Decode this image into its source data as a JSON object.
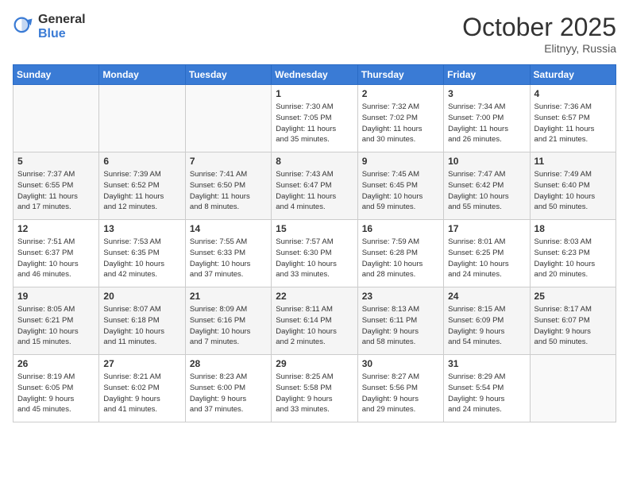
{
  "header": {
    "logo_general": "General",
    "logo_blue": "Blue",
    "month_title": "October 2025",
    "location": "Elitnyy, Russia"
  },
  "days_of_week": [
    "Sunday",
    "Monday",
    "Tuesday",
    "Wednesday",
    "Thursday",
    "Friday",
    "Saturday"
  ],
  "weeks": [
    [
      {
        "day": "",
        "info": ""
      },
      {
        "day": "",
        "info": ""
      },
      {
        "day": "",
        "info": ""
      },
      {
        "day": "1",
        "info": "Sunrise: 7:30 AM\nSunset: 7:05 PM\nDaylight: 11 hours\nand 35 minutes."
      },
      {
        "day": "2",
        "info": "Sunrise: 7:32 AM\nSunset: 7:02 PM\nDaylight: 11 hours\nand 30 minutes."
      },
      {
        "day": "3",
        "info": "Sunrise: 7:34 AM\nSunset: 7:00 PM\nDaylight: 11 hours\nand 26 minutes."
      },
      {
        "day": "4",
        "info": "Sunrise: 7:36 AM\nSunset: 6:57 PM\nDaylight: 11 hours\nand 21 minutes."
      }
    ],
    [
      {
        "day": "5",
        "info": "Sunrise: 7:37 AM\nSunset: 6:55 PM\nDaylight: 11 hours\nand 17 minutes."
      },
      {
        "day": "6",
        "info": "Sunrise: 7:39 AM\nSunset: 6:52 PM\nDaylight: 11 hours\nand 12 minutes."
      },
      {
        "day": "7",
        "info": "Sunrise: 7:41 AM\nSunset: 6:50 PM\nDaylight: 11 hours\nand 8 minutes."
      },
      {
        "day": "8",
        "info": "Sunrise: 7:43 AM\nSunset: 6:47 PM\nDaylight: 11 hours\nand 4 minutes."
      },
      {
        "day": "9",
        "info": "Sunrise: 7:45 AM\nSunset: 6:45 PM\nDaylight: 10 hours\nand 59 minutes."
      },
      {
        "day": "10",
        "info": "Sunrise: 7:47 AM\nSunset: 6:42 PM\nDaylight: 10 hours\nand 55 minutes."
      },
      {
        "day": "11",
        "info": "Sunrise: 7:49 AM\nSunset: 6:40 PM\nDaylight: 10 hours\nand 50 minutes."
      }
    ],
    [
      {
        "day": "12",
        "info": "Sunrise: 7:51 AM\nSunset: 6:37 PM\nDaylight: 10 hours\nand 46 minutes."
      },
      {
        "day": "13",
        "info": "Sunrise: 7:53 AM\nSunset: 6:35 PM\nDaylight: 10 hours\nand 42 minutes."
      },
      {
        "day": "14",
        "info": "Sunrise: 7:55 AM\nSunset: 6:33 PM\nDaylight: 10 hours\nand 37 minutes."
      },
      {
        "day": "15",
        "info": "Sunrise: 7:57 AM\nSunset: 6:30 PM\nDaylight: 10 hours\nand 33 minutes."
      },
      {
        "day": "16",
        "info": "Sunrise: 7:59 AM\nSunset: 6:28 PM\nDaylight: 10 hours\nand 28 minutes."
      },
      {
        "day": "17",
        "info": "Sunrise: 8:01 AM\nSunset: 6:25 PM\nDaylight: 10 hours\nand 24 minutes."
      },
      {
        "day": "18",
        "info": "Sunrise: 8:03 AM\nSunset: 6:23 PM\nDaylight: 10 hours\nand 20 minutes."
      }
    ],
    [
      {
        "day": "19",
        "info": "Sunrise: 8:05 AM\nSunset: 6:21 PM\nDaylight: 10 hours\nand 15 minutes."
      },
      {
        "day": "20",
        "info": "Sunrise: 8:07 AM\nSunset: 6:18 PM\nDaylight: 10 hours\nand 11 minutes."
      },
      {
        "day": "21",
        "info": "Sunrise: 8:09 AM\nSunset: 6:16 PM\nDaylight: 10 hours\nand 7 minutes."
      },
      {
        "day": "22",
        "info": "Sunrise: 8:11 AM\nSunset: 6:14 PM\nDaylight: 10 hours\nand 2 minutes."
      },
      {
        "day": "23",
        "info": "Sunrise: 8:13 AM\nSunset: 6:11 PM\nDaylight: 9 hours\nand 58 minutes."
      },
      {
        "day": "24",
        "info": "Sunrise: 8:15 AM\nSunset: 6:09 PM\nDaylight: 9 hours\nand 54 minutes."
      },
      {
        "day": "25",
        "info": "Sunrise: 8:17 AM\nSunset: 6:07 PM\nDaylight: 9 hours\nand 50 minutes."
      }
    ],
    [
      {
        "day": "26",
        "info": "Sunrise: 8:19 AM\nSunset: 6:05 PM\nDaylight: 9 hours\nand 45 minutes."
      },
      {
        "day": "27",
        "info": "Sunrise: 8:21 AM\nSunset: 6:02 PM\nDaylight: 9 hours\nand 41 minutes."
      },
      {
        "day": "28",
        "info": "Sunrise: 8:23 AM\nSunset: 6:00 PM\nDaylight: 9 hours\nand 37 minutes."
      },
      {
        "day": "29",
        "info": "Sunrise: 8:25 AM\nSunset: 5:58 PM\nDaylight: 9 hours\nand 33 minutes."
      },
      {
        "day": "30",
        "info": "Sunrise: 8:27 AM\nSunset: 5:56 PM\nDaylight: 9 hours\nand 29 minutes."
      },
      {
        "day": "31",
        "info": "Sunrise: 8:29 AM\nSunset: 5:54 PM\nDaylight: 9 hours\nand 24 minutes."
      },
      {
        "day": "",
        "info": ""
      }
    ]
  ]
}
